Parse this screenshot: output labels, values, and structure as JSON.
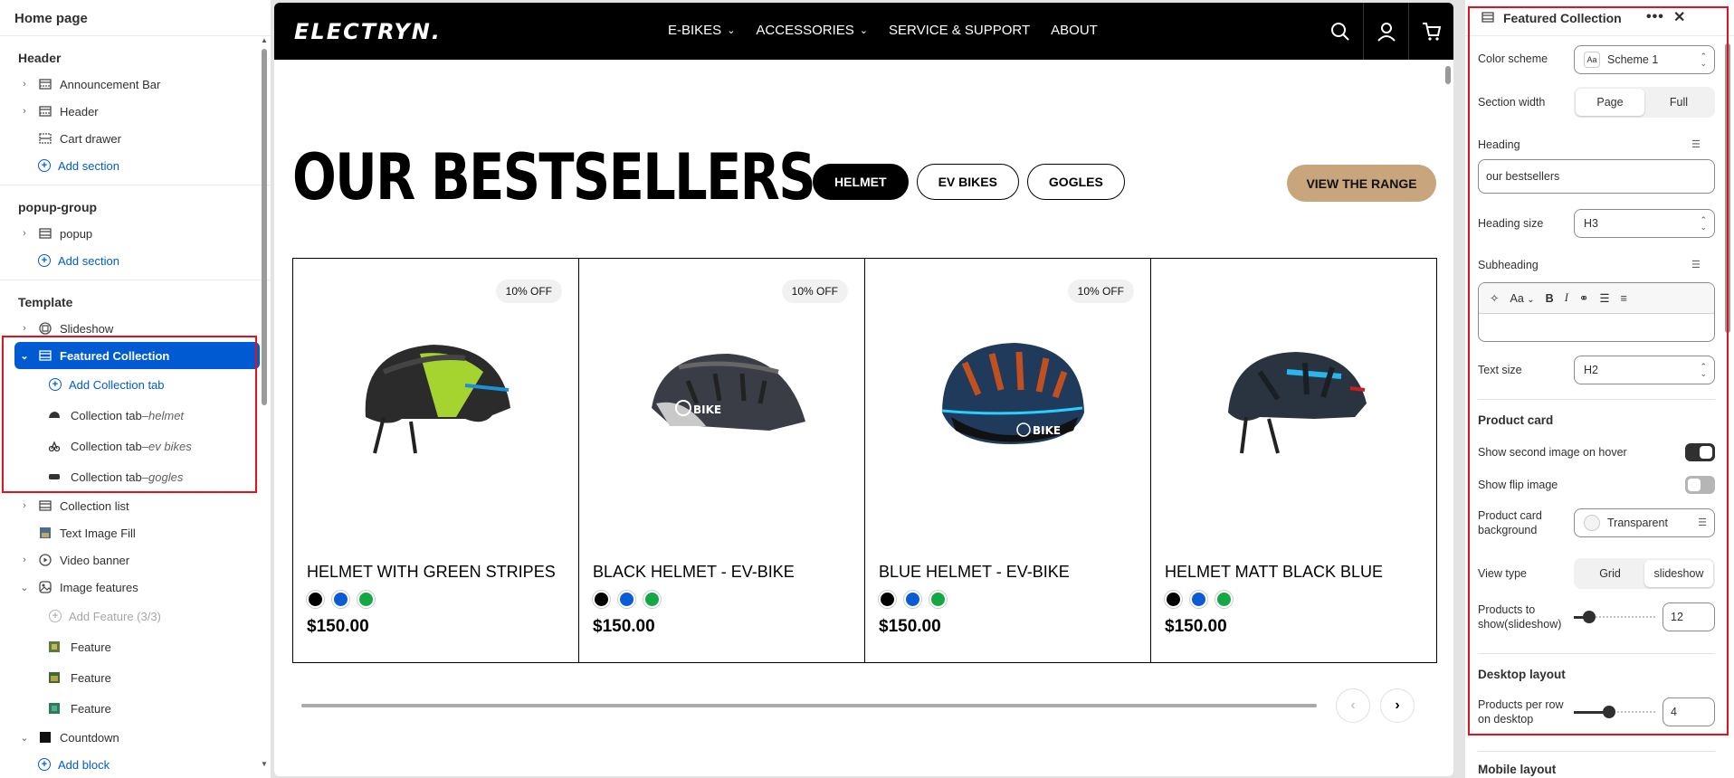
{
  "left": {
    "title": "Home page",
    "groups": [
      {
        "title": "Header",
        "items": [
          {
            "label": "Announcement Bar"
          },
          {
            "label": "Header"
          },
          {
            "label": "Cart drawer"
          }
        ],
        "add": "Add section"
      },
      {
        "title": "popup-group",
        "items": [
          {
            "label": "popup"
          }
        ],
        "add": "Add section"
      }
    ],
    "template": {
      "title": "Template",
      "slideshow": "Slideshow",
      "featured": "Featured Collection",
      "add_tab": "Add Collection tab",
      "tabs": [
        {
          "label": "Collection tab",
          "sep": " – ",
          "name": "helmet"
        },
        {
          "label": "Collection tab",
          "sep": " – ",
          "name": "ev bikes"
        },
        {
          "label": "Collection tab",
          "sep": " – ",
          "name": "gogles"
        }
      ],
      "collection_list": "Collection list",
      "text_image": "Text Image Fill",
      "video_banner": "Video banner",
      "image_features": "Image features",
      "add_feature": "Add Feature (3/3)",
      "features": [
        "Feature",
        "Feature",
        "Feature"
      ],
      "countdown": "Countdown",
      "add_block": "Add block"
    }
  },
  "preview": {
    "logo": "ELECTRYN.",
    "nav": [
      "E-BIKES",
      "ACCESSORIES",
      "SERVICE & SUPPORT",
      "ABOUT"
    ],
    "heading": "OUR BESTSELLERS",
    "tabs": [
      "HELMET",
      "EV BIKES",
      "GOGLES"
    ],
    "cta": "VIEW THE RANGE",
    "products": [
      {
        "badge": "10% OFF",
        "name": "HELMET WITH GREEN STRIPES",
        "price": "$150.00"
      },
      {
        "badge": "10% OFF",
        "name": "BLACK HELMET - EV-BIKE",
        "price": "$150.00"
      },
      {
        "badge": "10% OFF",
        "name": "BLUE HELMET - EV-BIKE",
        "price": "$150.00"
      },
      {
        "badge": "",
        "name": "HELMET MATT BLACK BLUE",
        "price": "$150.00"
      }
    ],
    "swatch_colors": [
      "#000000",
      "#0a5bd6",
      "#13a843"
    ],
    "accent": "#c9a57d"
  },
  "right": {
    "title": "Featured Collection",
    "color_scheme_label": "Color scheme",
    "color_scheme_value": "Scheme 1",
    "section_width_label": "Section width",
    "section_width_options": [
      "Page",
      "Full"
    ],
    "heading_label": "Heading",
    "heading_value": "our bestsellers",
    "heading_size_label": "Heading size",
    "heading_size_value": "H3",
    "subheading_label": "Subheading",
    "rte_font": "Aa",
    "text_size_label": "Text size",
    "text_size_value": "H2",
    "product_card_title": "Product card",
    "show_second_image_label": "Show second image on hover",
    "show_second_image": true,
    "show_flip_label": "Show flip image",
    "show_flip": false,
    "card_bg_label_1": "Product card",
    "card_bg_label_2": "background",
    "card_bg_value": "Transparent",
    "view_type_label": "View type",
    "view_type_options": [
      "Grid",
      "slideshow"
    ],
    "products_show_label_1": "Products to",
    "products_show_label_2": "show(slideshow)",
    "products_show_value": "12",
    "desktop_layout_title": "Desktop layout",
    "per_row_label_1": "Products per row",
    "per_row_label_2": "on desktop",
    "per_row_value": "4",
    "mobile_layout_title": "Mobile layout"
  }
}
